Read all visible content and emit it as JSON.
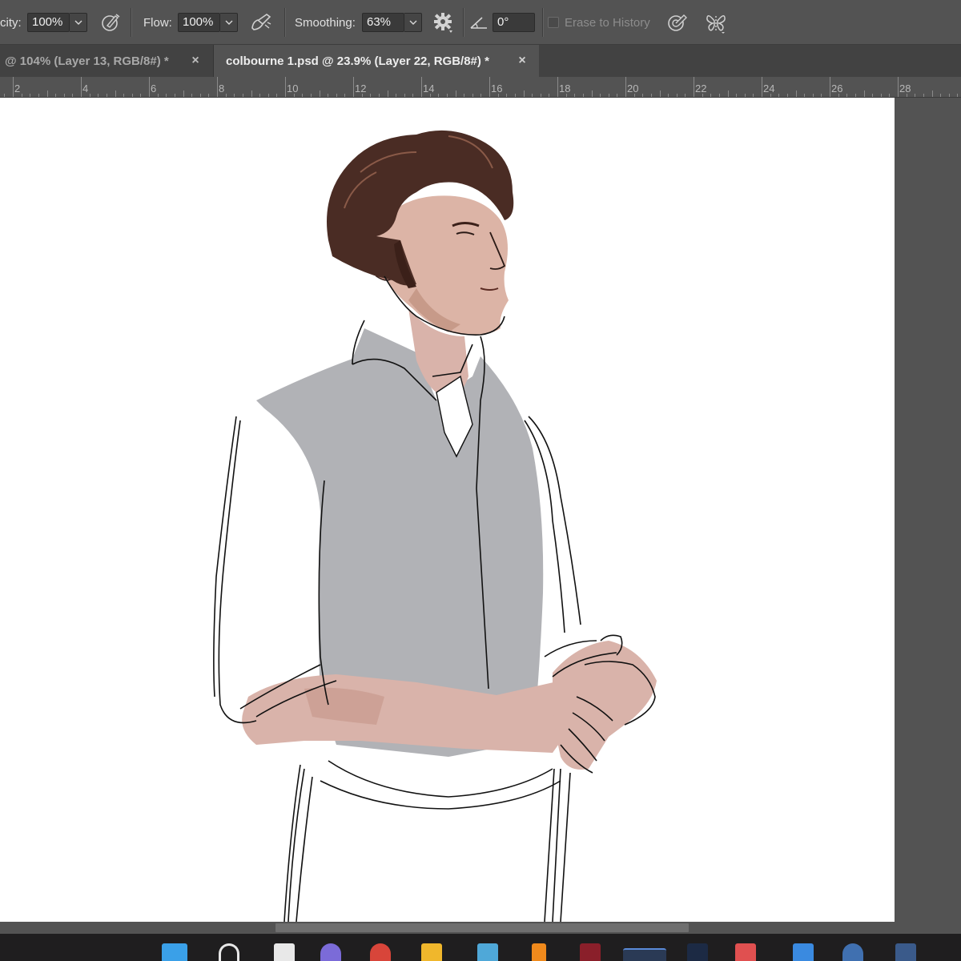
{
  "options_bar": {
    "opacity_label": "city:",
    "opacity_value": "100%",
    "flow_label": "Flow:",
    "flow_value": "100%",
    "smoothing_label": "Smoothing:",
    "smoothing_value": "63%",
    "angle_value": "0°",
    "erase_to_history_label": "Erase to History",
    "erase_to_history_checked": false,
    "icons": [
      "airbrush-pressure-icon",
      "airbrush-icon",
      "smoothing-settings-gear-icon",
      "angle-icon",
      "pressure-size-icon",
      "symmetry-butterfly-icon"
    ]
  },
  "tabs": [
    {
      "label": "@ 104% (Layer 13, RGB/8#) *",
      "active": false
    },
    {
      "label": "colbourne 1.psd @ 23.9% (Layer 22, RGB/8#) *",
      "active": true
    }
  ],
  "ruler": {
    "labels": [
      "2",
      "4",
      "6",
      "8",
      "10",
      "12",
      "14",
      "16",
      "18",
      "20",
      "22",
      "24",
      "26",
      "28"
    ]
  },
  "canvas": {
    "content": "portrait-illustration",
    "colors": {
      "hair": "#4a2c24",
      "skin": "#d9b3aa",
      "skin_shadow": "#c89a8d",
      "vest": "#b1b2b6",
      "shirt": "#ffffff",
      "line_art": "#111111"
    }
  },
  "colors": {
    "ui_panel": "#535353",
    "tab_bar": "#424242",
    "field_bg": "#3a3a3a",
    "taskbar": "#1f1e1f"
  },
  "taskbar": {
    "icons": [
      "windows-start-icon",
      "search-icon",
      "file-explorer-icon",
      "app-icon",
      "chrome-icon",
      "folder-icon",
      "photos-icon",
      "app-icon",
      "app-icon",
      "photoshop-icon",
      "app-icon",
      "calendar-icon",
      "app-icon",
      "app-icon"
    ]
  }
}
